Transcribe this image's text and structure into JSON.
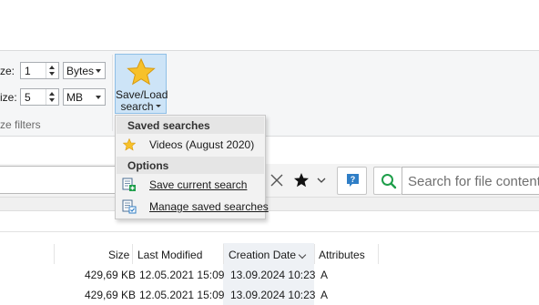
{
  "ribbon": {
    "size_min_label": "ze:",
    "size_min_value": "1",
    "size_min_unit": "Bytes",
    "size_max_label": "ize:",
    "size_max_value": "5",
    "size_max_unit": "MB",
    "group_label": "ze filters",
    "saveload_line1": "Save/Load",
    "saveload_line2": "search"
  },
  "menu": {
    "saved_header": "Saved searches",
    "saved_items": [
      {
        "label": "Videos (August 2020)",
        "icon": "star-icon"
      }
    ],
    "options_header": "Options",
    "save_current": "Save current search",
    "manage_saved": "Manage saved searches"
  },
  "search": {
    "fulltext_placeholder": "Search for file content"
  },
  "table": {
    "columns": [
      "Size",
      "Last Modified",
      "Creation Date",
      "Attributes"
    ],
    "sorted_column": "Creation Date",
    "rows": [
      {
        "size": "429,69 KB",
        "modified": "12.05.2021 15:09",
        "created": "13.09.2024 10:23",
        "attr": "A"
      },
      {
        "size": "429,69 KB",
        "modified": "12.05.2021 15:09",
        "created": "13.09.2024 10:23",
        "attr": "A"
      }
    ]
  },
  "colors": {
    "accent_star": "#f7c12a",
    "search_green": "#1e9e4a",
    "help_blue": "#2f7ec6",
    "saveload_bg": "#cde4f7"
  }
}
